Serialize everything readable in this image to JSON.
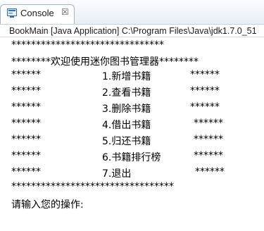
{
  "tab": {
    "label": "Console",
    "close_glyph": "☒"
  },
  "launch": {
    "text": "BookMain [Java Application] C:\\Program Files\\Java\\jdk1.7.0_51"
  },
  "console": {
    "top_border": "*******************************",
    "welcome": "********欢迎使用迷你图书管理器********",
    "menu": [
      {
        "left": "******",
        "item": "1.新增书籍",
        "right": "******"
      },
      {
        "left": "******",
        "item": "2.查看书籍",
        "right": "******"
      },
      {
        "left": "******",
        "item": "3.删除书籍",
        "right": "******"
      },
      {
        "left": "******",
        "item": "4.借出书籍",
        "right": "******"
      },
      {
        "left": "******",
        "item": "5.归还书籍",
        "right": "******"
      },
      {
        "left": "******",
        "item": "6.书籍排行榜",
        "right": "******"
      },
      {
        "left": "******",
        "item": "7.退出",
        "right": "******"
      }
    ],
    "bottom_border": "*********************************",
    "prompt": "请输入您的操作:"
  },
  "colors": {
    "tab_border": "#9fb3cc",
    "icon_blue": "#2b6cc4"
  },
  "icons": {
    "tab_icon": "console-icon"
  }
}
